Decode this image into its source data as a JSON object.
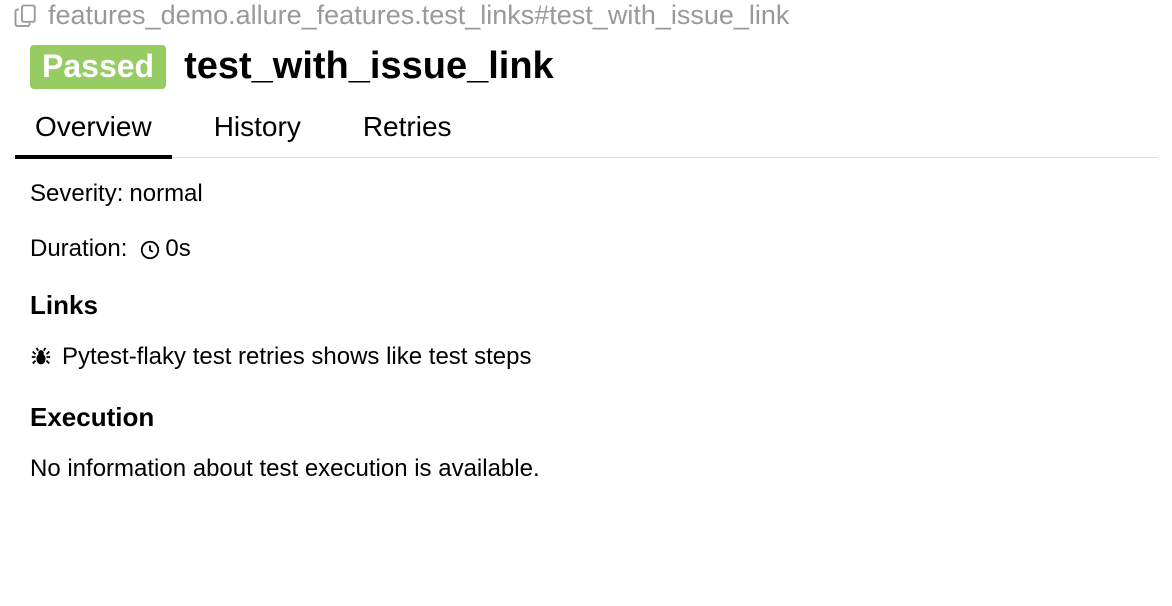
{
  "breadcrumb": {
    "full_name": "features_demo.allure_features.test_links#test_with_issue_link"
  },
  "status": {
    "label": "Passed",
    "color": "#97cc64"
  },
  "title": "test_with_issue_link",
  "tabs": {
    "overview": "Overview",
    "history": "History",
    "retries": "Retries"
  },
  "active_tab": "overview",
  "details": {
    "severity_label": "Severity",
    "severity_value": "normal",
    "duration_label": "Duration",
    "duration_value": "0s"
  },
  "links": {
    "heading": "Links",
    "items": [
      {
        "icon": "bug-icon",
        "text": "Pytest-flaky test retries shows like test steps"
      }
    ]
  },
  "execution": {
    "heading": "Execution",
    "empty_text": "No information about test execution is available."
  }
}
